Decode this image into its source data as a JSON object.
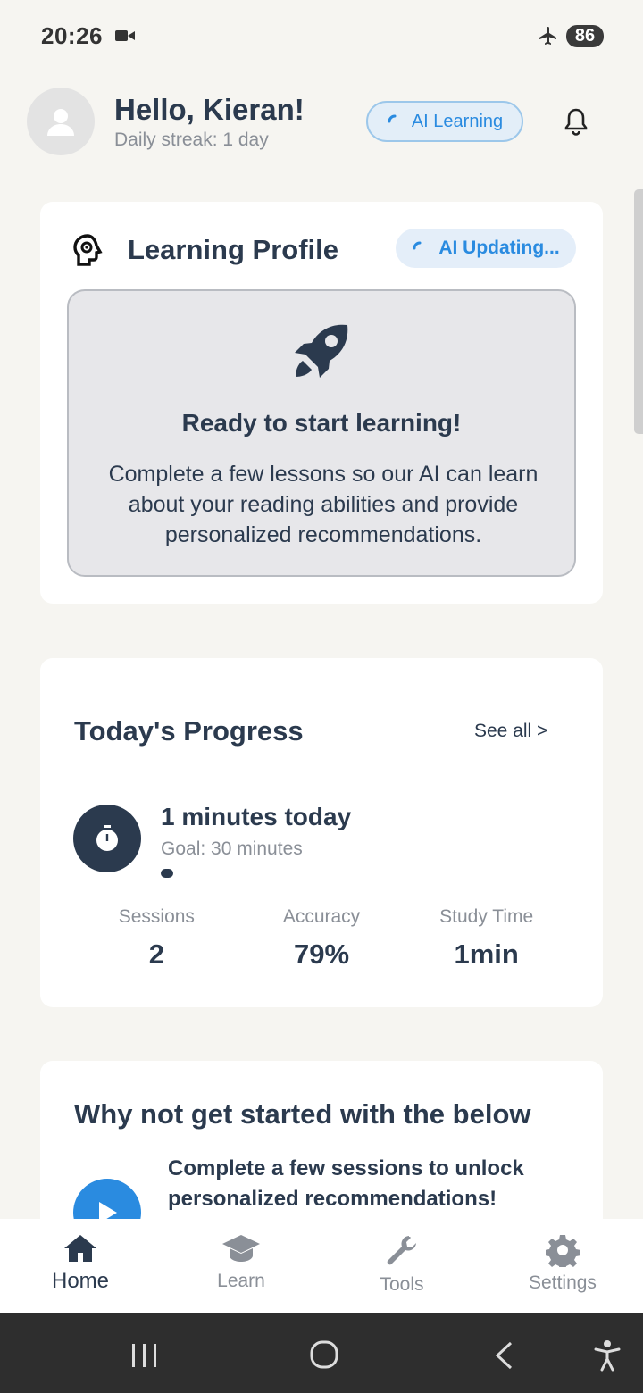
{
  "status_bar": {
    "time": "20:26",
    "battery": "86"
  },
  "header": {
    "greeting": "Hello, Kieran!",
    "streak": "Daily streak: 1 day",
    "ai_chip": "AI Learning"
  },
  "profile": {
    "title": "Learning Profile",
    "status_chip": "AI Updating...",
    "ready_title": "Ready to start learning!",
    "ready_text": "Complete a few lessons so our AI can learn about your reading abilities and provide personalized recommendations."
  },
  "progress": {
    "title": "Today's Progress",
    "see_all": "See all >",
    "minutes_text": "1 minutes today",
    "goal_text": "Goal: 30 minutes",
    "progress_percent": 3.3,
    "stats": [
      {
        "label": "Sessions",
        "value": "2"
      },
      {
        "label": "Accuracy",
        "value": "79%"
      },
      {
        "label": "Study Time",
        "value": "1min"
      }
    ]
  },
  "get_started": {
    "title": "Why not get started with the below",
    "text": "Complete a few sessions to unlock personalized recommendations!"
  },
  "bottom_nav": [
    {
      "label": "Home",
      "icon": "home-icon",
      "active": true
    },
    {
      "label": "Learn",
      "icon": "graduation-cap-icon",
      "active": false
    },
    {
      "label": "Tools",
      "icon": "wrench-icon",
      "active": false
    },
    {
      "label": "Settings",
      "icon": "gear-icon",
      "active": false
    }
  ],
  "colors": {
    "primary": "#2b3a4e",
    "accent": "#2a8be0",
    "background": "#f6f5f1"
  }
}
